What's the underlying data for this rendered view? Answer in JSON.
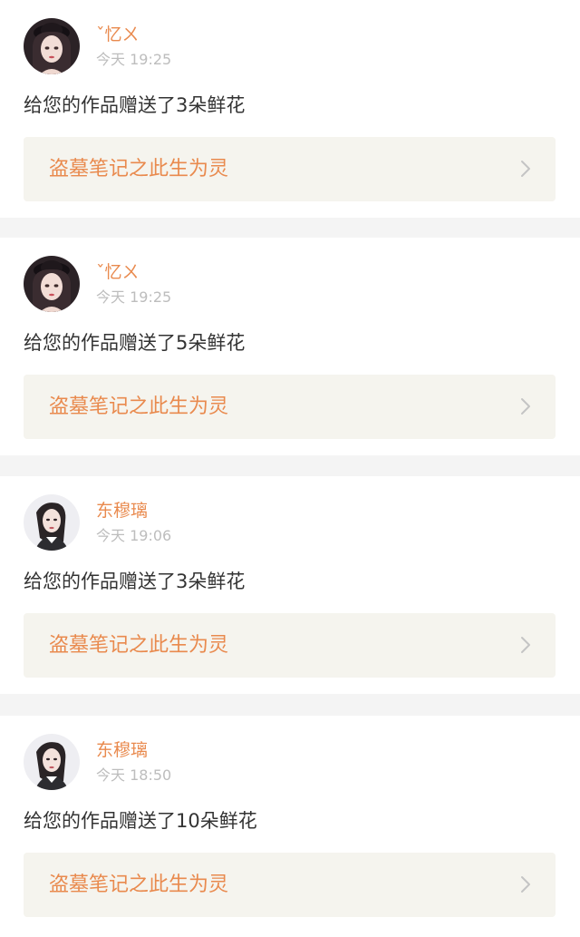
{
  "notifications": [
    {
      "user": "ˇ忆ㄨ",
      "time": "今天 19:25",
      "message": "给您的作品赠送了3朵鲜花",
      "work_title": "盗墓笔记之此生为灵",
      "avatar_icon": "girl-hat-avatar"
    },
    {
      "user": "ˇ忆ㄨ",
      "time": "今天 19:25",
      "message": "给您的作品赠送了5朵鲜花",
      "work_title": "盗墓笔记之此生为灵",
      "avatar_icon": "girl-hat-avatar"
    },
    {
      "user": "东穆璃",
      "time": "今天 19:06",
      "message": "给您的作品赠送了3朵鲜花",
      "work_title": "盗墓笔记之此生为灵",
      "avatar_icon": "girl-photo-avatar"
    },
    {
      "user": "东穆璃",
      "time": "今天 18:50",
      "message": "给您的作品赠送了10朵鲜花",
      "work_title": "盗墓笔记之此生为灵",
      "avatar_icon": "girl-photo-avatar"
    }
  ],
  "colors": {
    "accent": "#e98a4e",
    "message_text": "#333333",
    "timestamp": "#bdbdbd",
    "link_background": "#f5f4ee",
    "page_background": "#f4f4f4"
  },
  "icons": {
    "chevron": "chevron-right-icon"
  }
}
